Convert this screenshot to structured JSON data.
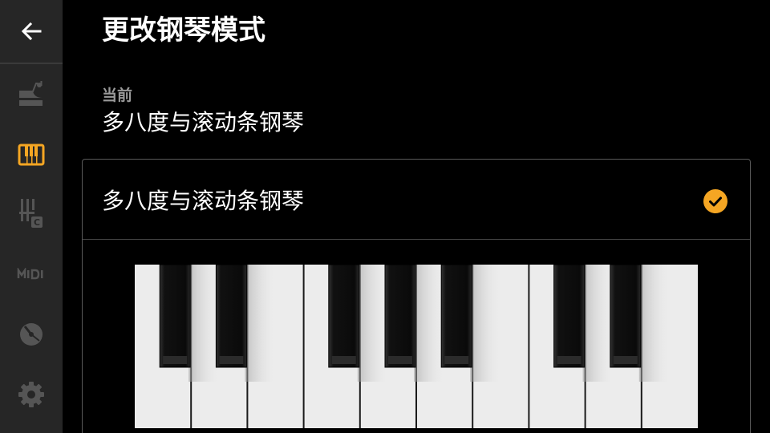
{
  "header": {
    "title": "更改钢琴模式"
  },
  "current": {
    "label": "当前",
    "value": "多八度与滚动条钢琴"
  },
  "options": [
    {
      "label": "多八度与滚动条钢琴",
      "selected": true
    }
  ],
  "sidebar": {
    "items": [
      {
        "icon": "grand-piano-icon",
        "active": false
      },
      {
        "icon": "keyboard-icon",
        "active": true
      },
      {
        "icon": "chord-c-icon",
        "active": false
      },
      {
        "icon": "midi-icon",
        "active": false
      },
      {
        "icon": "record-disc-icon",
        "active": false
      },
      {
        "icon": "settings-gear-icon",
        "active": false
      }
    ]
  },
  "colors": {
    "accent": "#f5a623",
    "sidebar_bg": "#262626",
    "icon_inactive": "#555555"
  }
}
